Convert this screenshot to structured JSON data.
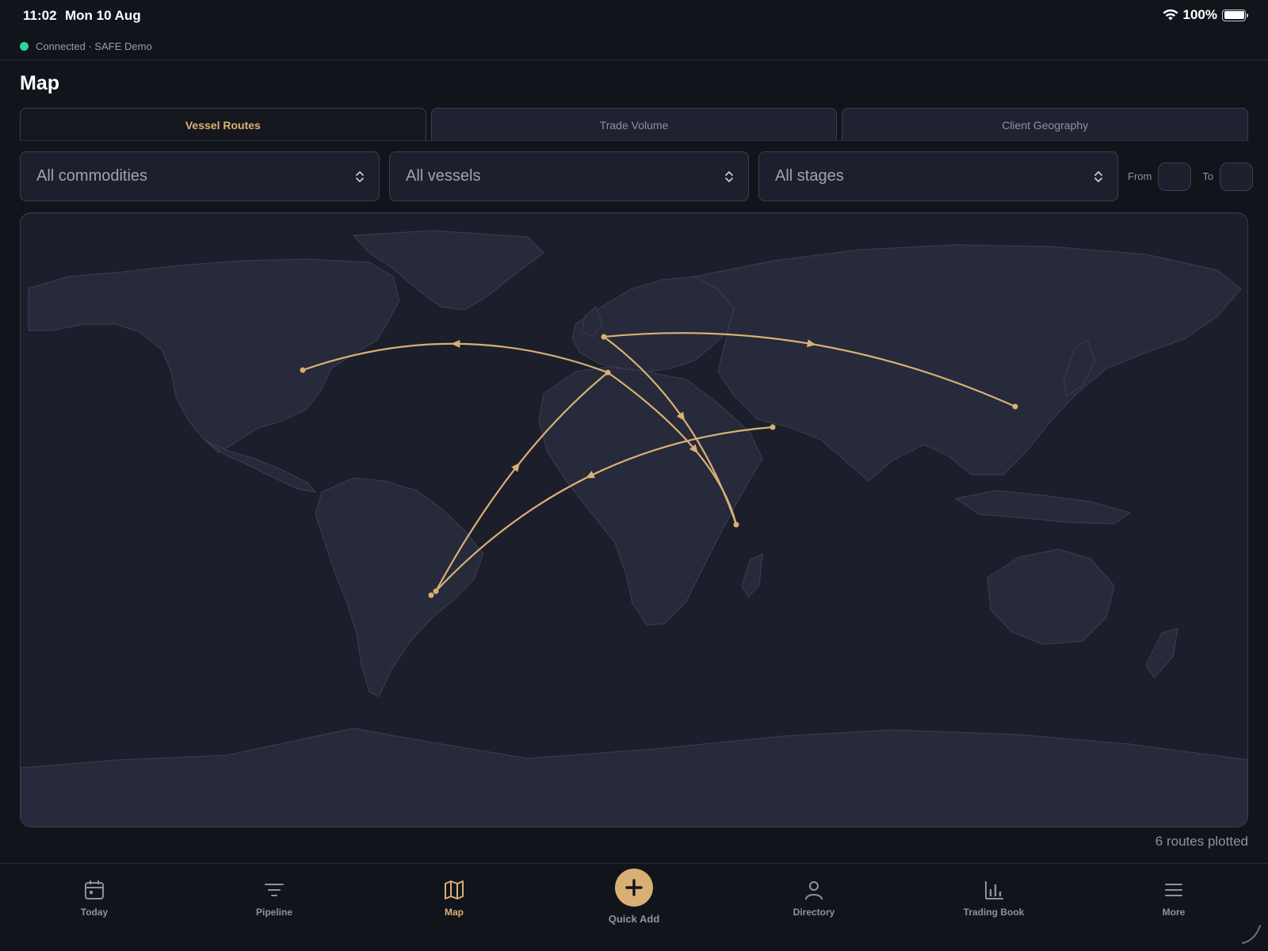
{
  "status_bar": {
    "time": "11:02",
    "date": "Mon 10 Aug",
    "battery": "100%"
  },
  "connection": {
    "text": "Connected · SAFE Demo",
    "color": "#2fd49a"
  },
  "page": {
    "title": "Map"
  },
  "tabs": [
    {
      "label": "Vessel Routes",
      "active": true
    },
    {
      "label": "Trade Volume",
      "active": false
    },
    {
      "label": "Client Geography",
      "active": false
    }
  ],
  "filters": {
    "commodity": "All commodities",
    "vessel": "All vessels",
    "stage": "All stages",
    "from_label": "From",
    "to_label": "To"
  },
  "map": {
    "route_color": "#d9b074",
    "routes_summary": "6 routes plotted"
  },
  "nav": {
    "items": [
      {
        "label": "Today",
        "icon": "calendar-icon"
      },
      {
        "label": "Pipeline",
        "icon": "filter-lines-icon"
      },
      {
        "label": "Map",
        "icon": "map-icon",
        "active": true
      },
      {
        "label": "Quick Add",
        "icon": "plus-icon"
      },
      {
        "label": "Directory",
        "icon": "person-icon"
      },
      {
        "label": "Trading Book",
        "icon": "bar-chart-icon"
      },
      {
        "label": "More",
        "icon": "menu-icon"
      }
    ]
  },
  "colors": {
    "accent": "#d9b074",
    "background": "#12141c",
    "surface": "#1f2230"
  }
}
